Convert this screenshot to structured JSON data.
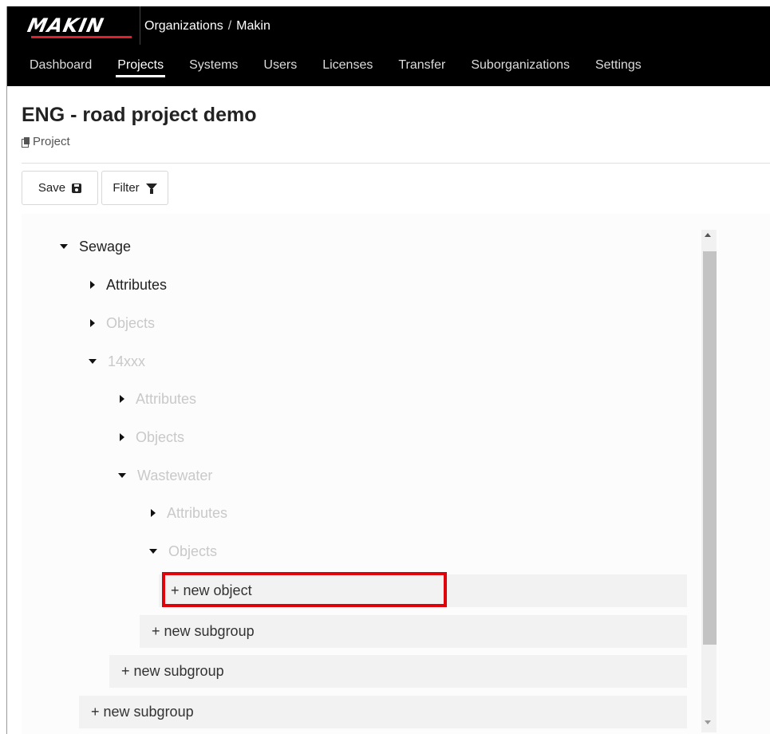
{
  "header": {
    "logo_text": "MAKIN",
    "breadcrumb": [
      "Organizations",
      "Makin"
    ],
    "breadcrumb_separator": "/",
    "nav": [
      "Dashboard",
      "Projects",
      "Systems",
      "Users",
      "Licenses",
      "Transfer",
      "Suborganizations",
      "Settings"
    ],
    "active_nav": "Projects"
  },
  "page": {
    "title": "ENG - road project demo",
    "subtitle": "Project",
    "subtitle_icon": "copy-icon"
  },
  "toolbar": {
    "save_label": "Save",
    "save_icon": "floppy-disk-icon",
    "filter_label": "Filter",
    "filter_icon": "funnel-icon"
  },
  "tree": {
    "sewage": "Sewage",
    "sewage_attributes": "Attributes",
    "sewage_objects": "Objects",
    "group_14xxx": "14xxx",
    "g14_attributes": "Attributes",
    "g14_objects": "Objects",
    "wastewater": "Wastewater",
    "ww_attributes": "Attributes",
    "ww_objects": "Objects",
    "new_object": "+ new object",
    "new_subgroup_ww": "+ new subgroup",
    "new_subgroup_14": "+ new subgroup",
    "new_subgroup_sewage": "+ new subgroup"
  },
  "colors": {
    "topbar": "#000000",
    "logo_stripe": "#e0212b",
    "highlight": "#e0000b",
    "dim_text": "#c9c9c9"
  }
}
